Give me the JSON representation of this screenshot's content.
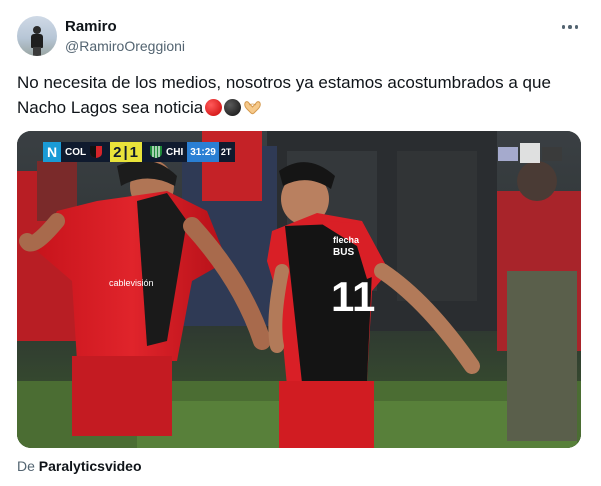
{
  "tweet": {
    "display_name": "Ramiro",
    "handle": "@RamiroOreggioni",
    "text_line1": "No necesita de los medios, nosotros ya estamos acostumbrados a que",
    "text_line2": "Nacho Lagos sea noticia",
    "emojis": [
      "red-circle-icon",
      "black-circle-icon",
      "heart-hands-icon"
    ]
  },
  "media": {
    "scorebug": {
      "channel_logo": "N",
      "home_team": "COL",
      "home_score": "2",
      "away_score": "1",
      "away_team": "CHI",
      "clock": "31:29",
      "period": "2T"
    },
    "players": {
      "shirt_number": "11",
      "shirt_sponsor_left": "cablevisión",
      "shirt_sponsor_right_1": "flecha",
      "shirt_sponsor_right_2": "BUS"
    }
  },
  "attribution": {
    "prefix": "De",
    "source": "Paralyticsvideo"
  },
  "colors": {
    "text": "#0f1419",
    "secondary": "#536471",
    "colon_red": "#d6242a",
    "scorebug_navy": "#0f1a2e",
    "scorebug_yellow": "#e9e33a",
    "scorebug_blue": "#2a7fd4"
  }
}
